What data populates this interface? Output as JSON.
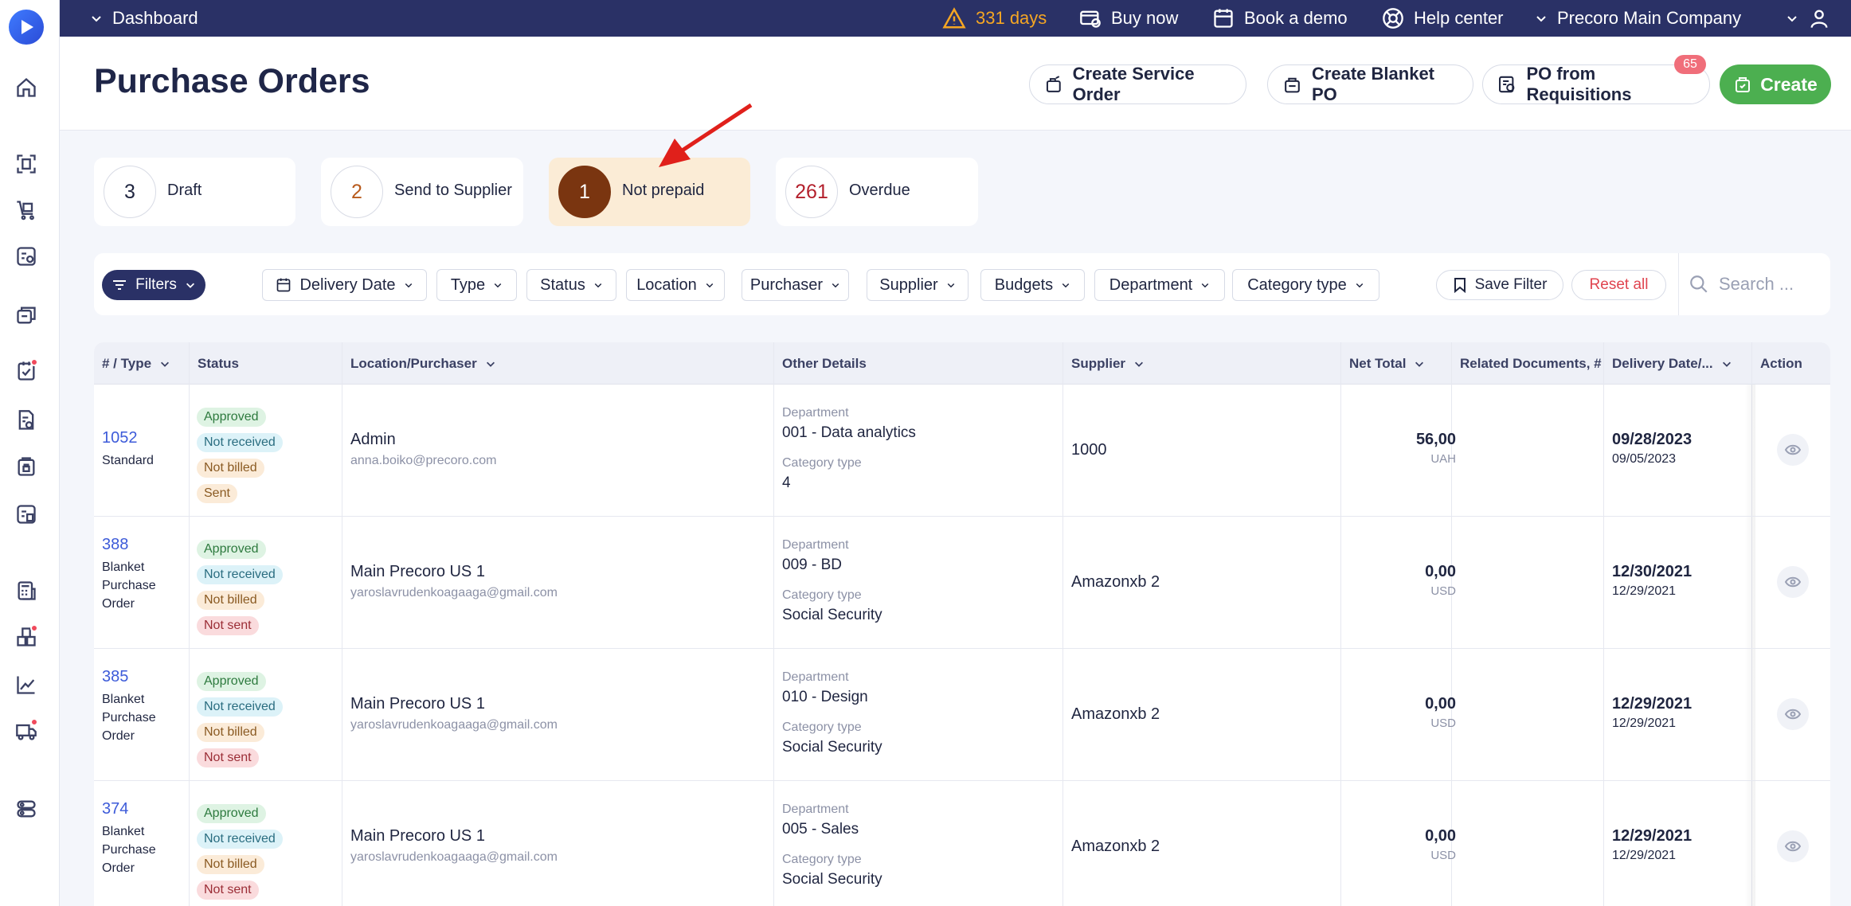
{
  "topbar": {
    "dashboard": "Dashboard",
    "trial_days": "331 days",
    "buy_now": "Buy now",
    "book_demo": "Book a demo",
    "help_center": "Help center",
    "company": "Precoro Main Company"
  },
  "header": {
    "title": "Purchase Orders",
    "btn_service_order": "Create Service Order",
    "btn_blanket_po": "Create Blanket PO",
    "btn_po_requisitions": "PO from Requisitions",
    "requisitions_badge": "65",
    "btn_create": "Create"
  },
  "status_cards": [
    {
      "count": "3",
      "label": "Draft"
    },
    {
      "count": "2",
      "label": "Send to Supplier"
    },
    {
      "count": "1",
      "label": "Not prepaid"
    },
    {
      "count": "261",
      "label": "Overdue"
    }
  ],
  "filters": {
    "filters_label": "Filters",
    "chips": [
      "Delivery Date",
      "Type",
      "Status",
      "Location",
      "Purchaser",
      "Supplier",
      "Budgets",
      "Department",
      "Category type"
    ],
    "save_filter": "Save Filter",
    "reset_all": "Reset all",
    "search_placeholder": "Search ..."
  },
  "table": {
    "columns": [
      "# / Type",
      "Status",
      "Location/Purchaser",
      "Other Details",
      "Supplier",
      "Net Total",
      "Related Documents, #",
      "Delivery Date/...",
      "Action"
    ],
    "department_label": "Department",
    "category_label": "Category type",
    "rows": [
      {
        "number": "1052",
        "type_lines": [
          "Standard"
        ],
        "statuses": [
          "Approved",
          "Not received",
          "Not billed",
          "Sent"
        ],
        "location": "Admin",
        "email": "anna.boiko@precoro.com",
        "department": "001 - Data analytics",
        "category": "4",
        "supplier": "1000",
        "net_total": "56,00",
        "currency": "UAH",
        "delivery_date": "09/28/2023",
        "created_date": "09/05/2023"
      },
      {
        "number": "388",
        "type_lines": [
          "Blanket",
          "Purchase",
          "Order"
        ],
        "statuses": [
          "Approved",
          "Not received",
          "Not billed",
          "Not sent"
        ],
        "location": "Main Precoro US 1",
        "email": "yaroslavrudenkoagaaga@gmail.com",
        "department": "009 - BD",
        "category": "Social Security",
        "supplier": "Amazonxb 2",
        "net_total": "0,00",
        "currency": "USD",
        "delivery_date": "12/30/2021",
        "created_date": "12/29/2021"
      },
      {
        "number": "385",
        "type_lines": [
          "Blanket",
          "Purchase",
          "Order"
        ],
        "statuses": [
          "Approved",
          "Not received",
          "Not billed",
          "Not sent"
        ],
        "location": "Main Precoro US 1",
        "email": "yaroslavrudenkoagaaga@gmail.com",
        "department": "010 - Design",
        "category": "Social Security",
        "supplier": "Amazonxb 2",
        "net_total": "0,00",
        "currency": "USD",
        "delivery_date": "12/29/2021",
        "created_date": "12/29/2021"
      },
      {
        "number": "374",
        "type_lines": [
          "Blanket",
          "Purchase",
          "Order"
        ],
        "statuses": [
          "Approved",
          "Not received",
          "Not billed",
          "Not sent"
        ],
        "location": "Main Precoro US 1",
        "email": "yaroslavrudenkoagaaga@gmail.com",
        "department": "005 - Sales",
        "category": "Social Security",
        "supplier": "Amazonxb 2",
        "net_total": "0,00",
        "currency": "USD",
        "delivery_date": "12/29/2021",
        "created_date": "12/29/2021"
      }
    ]
  },
  "colors": {
    "topbar": "#2a3166",
    "create_green": "#4caf50",
    "link_blue": "#3d5bd9",
    "annotation_arrow": "#e0201b",
    "active_card": "#fbecd6",
    "active_circle": "#7a3510"
  }
}
